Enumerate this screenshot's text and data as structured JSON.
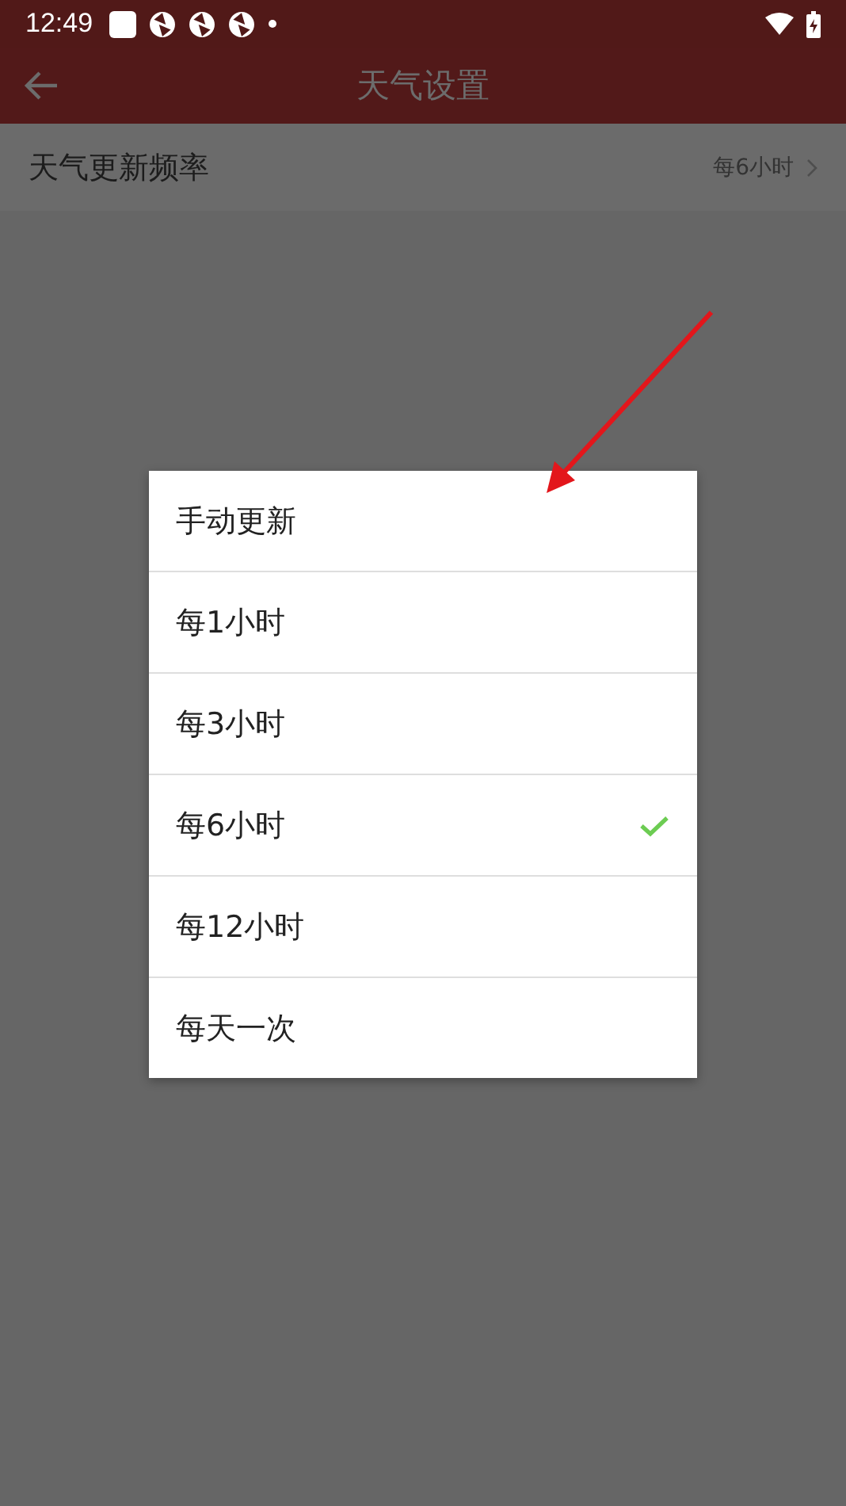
{
  "status_bar": {
    "time": "12:49"
  },
  "app_bar": {
    "title": "天气设置"
  },
  "setting": {
    "label": "天气更新频率",
    "value": "每6小时"
  },
  "dialog": {
    "options": [
      {
        "label": "手动更新",
        "selected": false
      },
      {
        "label": "每1小时",
        "selected": false
      },
      {
        "label": "每3小时",
        "selected": false
      },
      {
        "label": "每6小时",
        "selected": true
      },
      {
        "label": "每12小时",
        "selected": false
      },
      {
        "label": "每天一次",
        "selected": false
      }
    ]
  }
}
